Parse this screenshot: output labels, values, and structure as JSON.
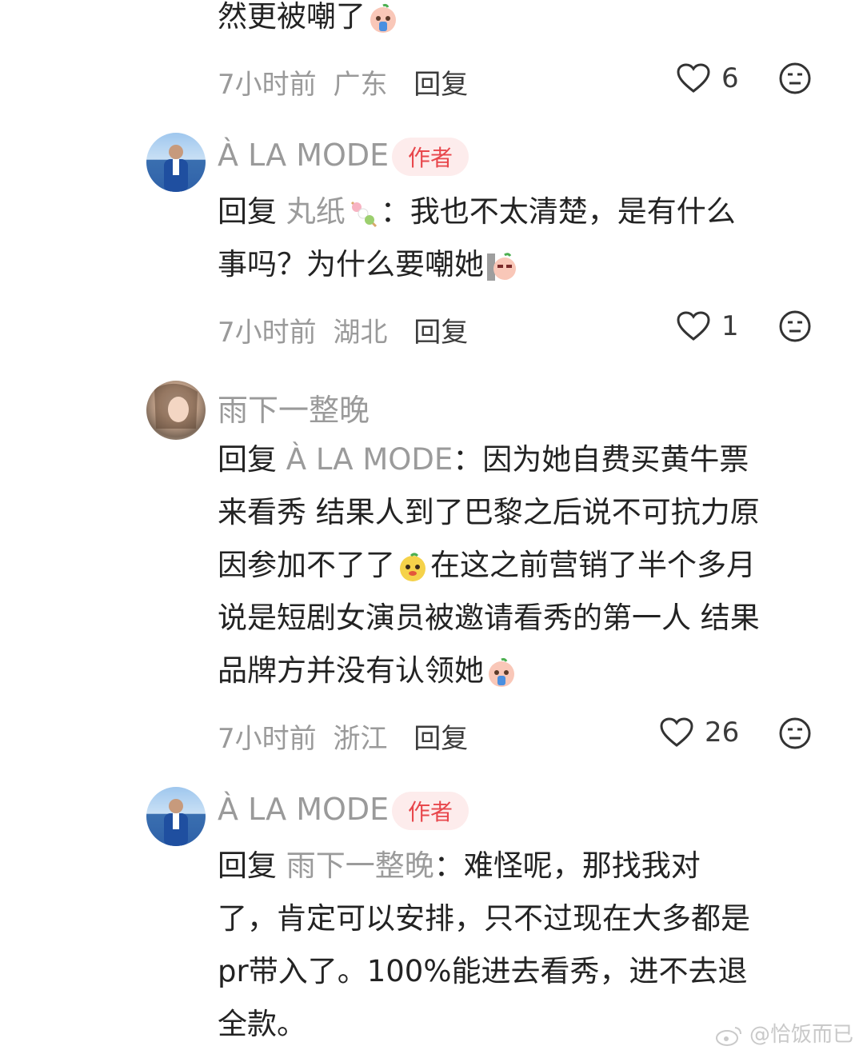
{
  "c0": {
    "tail_text": "然更被嘲了",
    "emoji": "crying-peach-emoji",
    "time": "7小时前",
    "location": "广东",
    "reply": "回复",
    "likes": "6"
  },
  "c1": {
    "username": "À LA MODE",
    "badge": "作者",
    "reply_prefix": "回复",
    "mention": "丸纸",
    "mention_emoji": "dango-emoji",
    "line1": "：我也不太清楚，是有什么",
    "line2": "事吗？为什么要嘲她",
    "emoji": "peeking-peach-emoji",
    "time": "7小时前",
    "location": "湖北",
    "reply": "回复",
    "likes": "1"
  },
  "c2": {
    "username": "雨下一整晚",
    "reply_prefix": "回复",
    "mention": "À LA MODE",
    "line1": "：因为她自费买黄牛票",
    "line2": "来看秀 结果人到了巴黎之后说不可抗力原",
    "line3a": "因参加不了了",
    "emoji1": "mango-face-emoji",
    "line3b": "在这之前营销了半个多月",
    "line4": "说是短剧女演员被邀请看秀的第一人 结果",
    "line5": "品牌方并没有认领她",
    "emoji2": "crying-peach-emoji",
    "time": "7小时前",
    "location": "浙江",
    "reply": "回复",
    "likes": "26"
  },
  "c3": {
    "username": "À LA MODE",
    "badge": "作者",
    "reply_prefix": "回复",
    "mention": "雨下一整晚",
    "line1": "：难怪呢，那找我对",
    "line2": "了，肯定可以安排，只不过现在大多都是",
    "line3": "pr带入了。100%能进去看秀，进不去退",
    "line4": "全款。"
  },
  "watermark": "@恰饭而已",
  "colors": {
    "badge_bg": "#fdecec",
    "badge_text": "#e8474c",
    "meta": "#9a9a9a",
    "body": "#232323"
  }
}
